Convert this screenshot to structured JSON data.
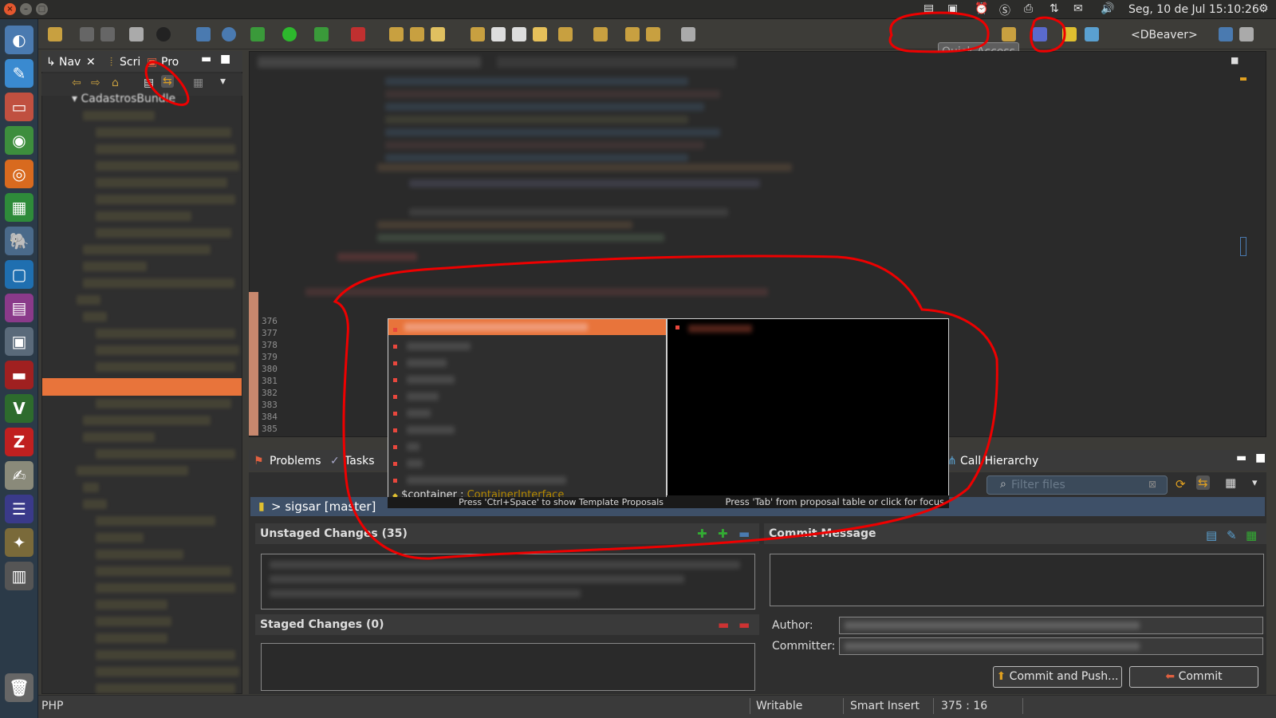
{
  "system": {
    "datetime": "Seg, 10 de Jul 15:10:26"
  },
  "toolbar": {
    "quick_access": "Quick Access",
    "perspective": "<DBeaver>"
  },
  "left_panel": {
    "tabs": [
      {
        "label": "Nav"
      },
      {
        "label": "Scri"
      },
      {
        "label": "Pro"
      }
    ],
    "root_node": "CadastrosBundle"
  },
  "editor": {
    "line_numbers": [
      "376",
      "377",
      "378",
      "379",
      "380",
      "381",
      "382",
      "383",
      "384",
      "385"
    ]
  },
  "proposal_popup": {
    "last_item_name": "$container",
    "last_item_type": "ContainerInterface",
    "hint": "Press 'Ctrl+Space' to show Template Proposals"
  },
  "doc_popup": {
    "hint": "Press 'Tab' from proposal table or click for focus"
  },
  "bottom_panel": {
    "tabs": [
      {
        "label": "Problems"
      },
      {
        "label": "Tasks"
      },
      {
        "label": "Call Hierarchy"
      }
    ],
    "filter_placeholder": "Filter files",
    "repo_label": "> sigsar [master]",
    "unstaged_header": "Unstaged Changes (35)",
    "staged_header": "Staged Changes (0)",
    "commit_message_header": "Commit Message",
    "author_label": "Author:",
    "committer_label": "Committer:",
    "commit_push_button": "Commit and Push...",
    "commit_button": "Commit"
  },
  "statusbar": {
    "language": "PHP",
    "writable": "Writable",
    "insert_mode": "Smart Insert",
    "position": "375 : 16"
  }
}
